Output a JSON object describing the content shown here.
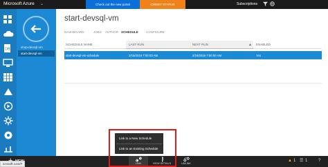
{
  "header": {
    "brand": "Microsoft Azure",
    "brand_caret": "⌄",
    "promo": "Check out the new portal",
    "credit_status": "CREDIT STATUS",
    "subscriptions": "Subscriptions",
    "filter_icon": "filter-icon",
    "globe_icon": "globe-icon"
  },
  "rail": {
    "icons": [
      "all-items-icon",
      "cloud-services-icon",
      "sql-database-icon",
      "virtual-machines-icon",
      "storage-icon",
      "hdinsight-icon",
      "media-services-icon",
      "automation-icon",
      "service-bus-icon",
      "settings-icon"
    ]
  },
  "subnav": {
    "back_icon": "back-arrow-icon",
    "items": [
      {
        "label": "shop-devsql-vm"
      },
      {
        "label": "start-devsql-vm"
      }
    ]
  },
  "main": {
    "title": "start-devsql-vm",
    "tabs": [
      "DASHBOARD",
      "JOBS",
      "AUTHOR",
      "SCHEDULE",
      "CONFIGURE"
    ],
    "active_tab": "SCHEDULE",
    "table": {
      "columns": [
        "SCHEDULE NAME",
        "LAST RUN",
        "NEXT RUN",
        "ENABLED"
      ],
      "sort_indicator": "▲",
      "rows": [
        {
          "name": "start-devsql-vm-schedule",
          "last_run": "2/15/2016 7:00:03 AM",
          "next_run": "2/16/2016 7:00:00 AM",
          "enabled": "Yes"
        }
      ]
    }
  },
  "flyout": {
    "items": [
      "Link to a New Schedule",
      "Link to an Existing Schedule"
    ]
  },
  "commands": {
    "new_label": "NEW",
    "link": "LINK",
    "view_details": "VIEW DETAILS",
    "unlink": "UNLINK",
    "status_url": "icrosoft.com/#"
  },
  "status": {
    "warning_count": "1",
    "list_count": "1",
    "help": "?"
  },
  "colors": {
    "accent": "#1c89d4",
    "rail": "#1a7bbf",
    "highlight": "#e01a1a",
    "credit": "#f1811a",
    "promo": "#0a6fd8"
  }
}
